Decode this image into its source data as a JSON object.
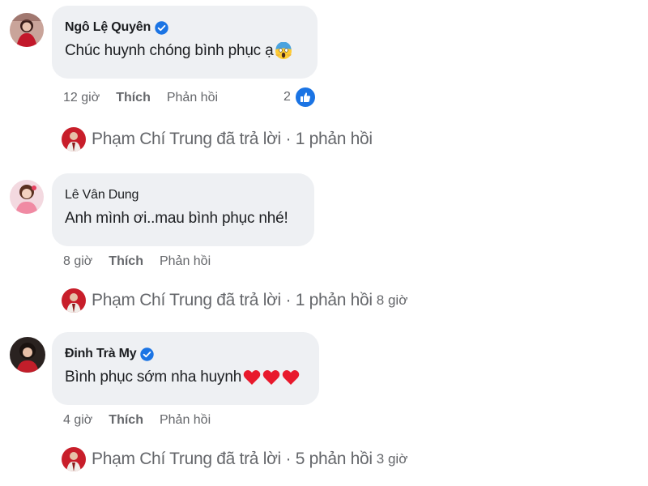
{
  "comments": [
    {
      "author": "Ngô Lệ Quyên",
      "verified": true,
      "text": "Chúc huynh chóng bình phục ạ",
      "emoji": "face-screaming-in-fear",
      "time": "12 giờ",
      "like_label": "Thích",
      "reply_label": "Phản hồi",
      "reaction_count": "2",
      "reaction_icon": "like-icon",
      "replies": {
        "author": "Phạm Chí Trung",
        "verb": "đã trả lời",
        "separator": "·",
        "count_label": "1 phản hồi",
        "time": ""
      }
    },
    {
      "author": "Lê Vân Dung",
      "verified": false,
      "text": "Anh mình ơi..mau bình phục nhé!",
      "emoji": "",
      "time": "8 giờ",
      "like_label": "Thích",
      "reply_label": "Phản hồi",
      "replies": {
        "author": "Phạm Chí Trung",
        "verb": "đã trả lời",
        "separator": "·",
        "count_label": "1 phản hồi",
        "time": "8 giờ"
      }
    },
    {
      "author": "Đinh Trà My",
      "verified": true,
      "text": "Bình phục sớm nha huynh",
      "emoji": "red-heart x3",
      "time": "4 giờ",
      "like_label": "Thích",
      "reply_label": "Phản hồi",
      "replies": {
        "author": "Phạm Chí Trung",
        "verb": "đã trả lời",
        "separator": "·",
        "count_label": "5 phản hồi",
        "time": "3 giờ"
      }
    }
  ],
  "colors": {
    "bubble": "#eef0f3",
    "text": "#1c1e21",
    "meta": "#65676b",
    "verified": "#1b74e4",
    "like_badge": "#1b74e4",
    "heart": "#e8192c"
  }
}
